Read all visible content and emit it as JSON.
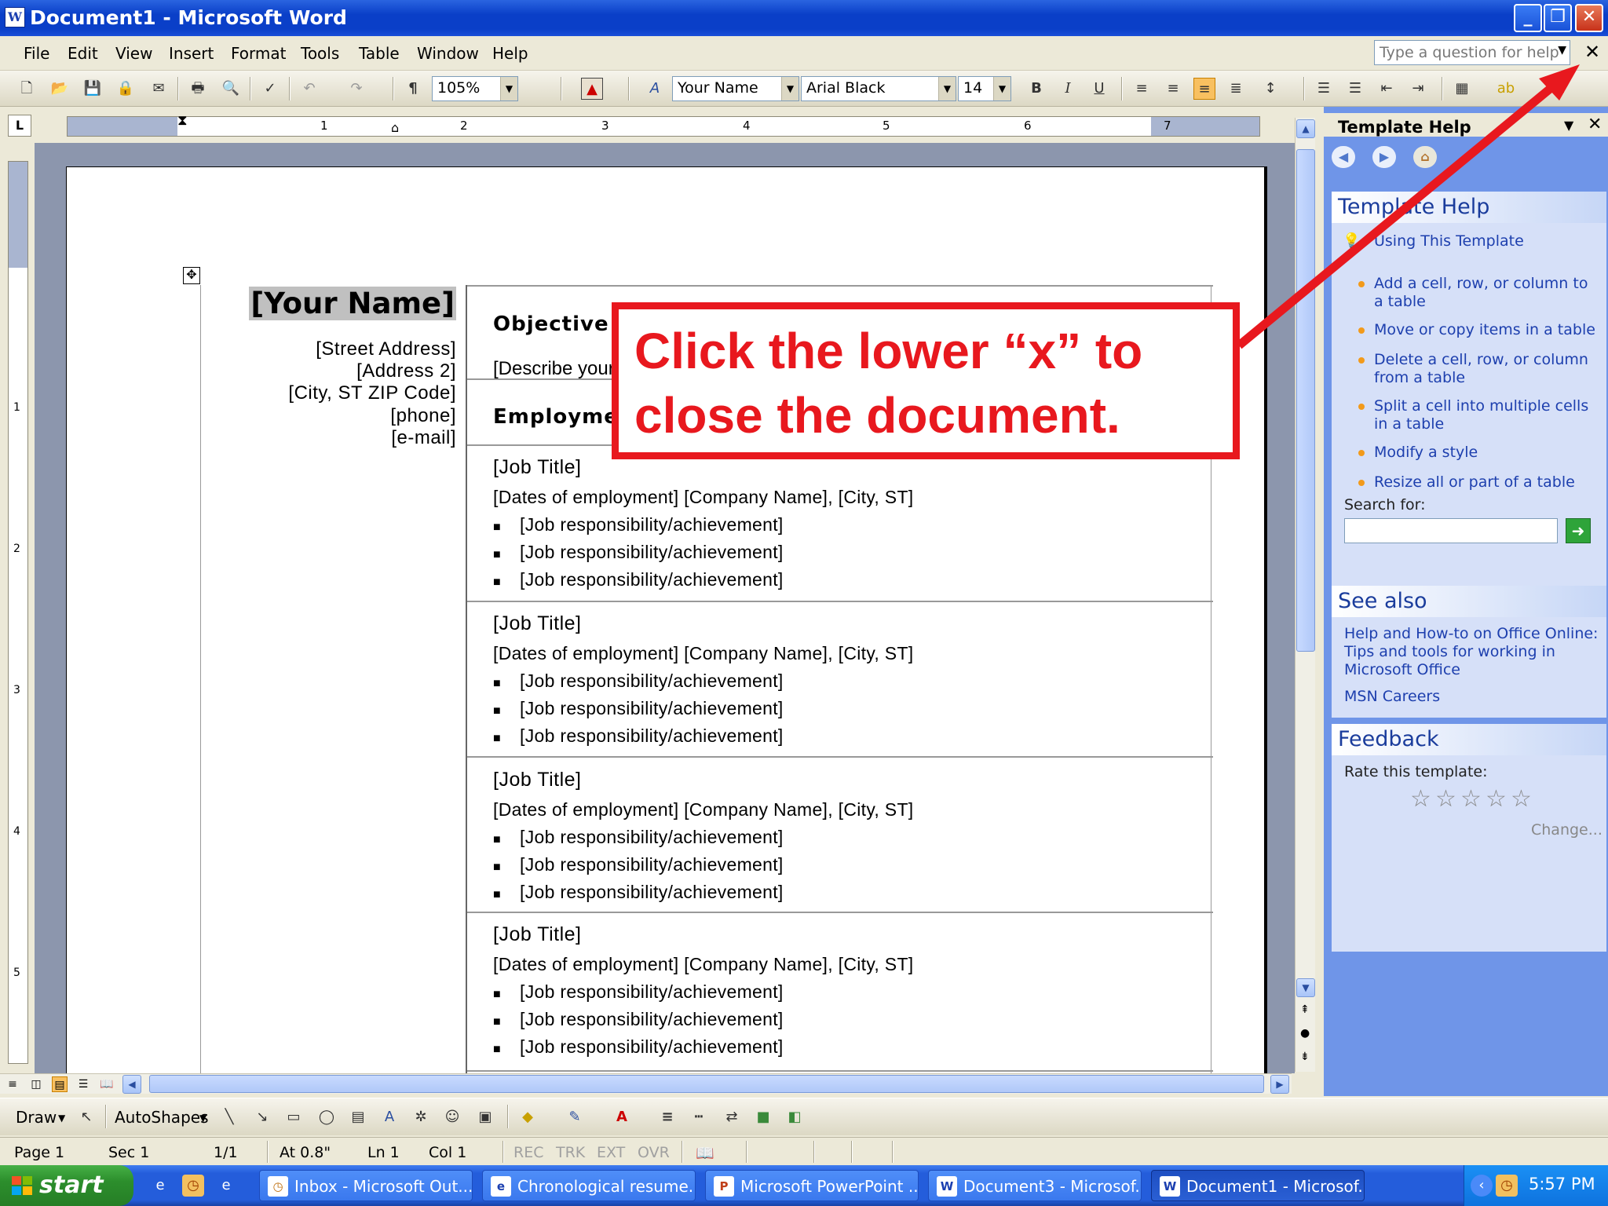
{
  "window": {
    "title": "Document1 - Microsoft Word"
  },
  "menu": {
    "items": [
      "File",
      "Edit",
      "View",
      "Insert",
      "Format",
      "Tools",
      "Table",
      "Window",
      "Help"
    ],
    "help_placeholder": "Type a question for help"
  },
  "toolbar": {
    "zoom": "105%",
    "style": "Your Name",
    "font": "Arial Black",
    "size": "14",
    "bold": "B",
    "italic": "I",
    "underline": "U"
  },
  "ruler": {
    "numbers": [
      "1",
      "2",
      "3",
      "4",
      "5",
      "6",
      "7"
    ],
    "vnumbers": [
      "1",
      "2",
      "3",
      "4",
      "5"
    ]
  },
  "resume": {
    "name": "[Your Name]",
    "address": [
      "[Street Address]",
      "[Address 2]",
      "[City, ST  ZIP Code]",
      "[phone]",
      "[e-mail]"
    ],
    "objective_heading": "Objective",
    "objective_text": "[Describe your care",
    "employment_heading": "Employment Hi",
    "jobs": [
      {
        "title": "[Job Title]",
        "dates": "[Dates of employment]  [Company Name], [City, ST]",
        "items": [
          "[Job responsibility/achievement]",
          "[Job responsibility/achievement]",
          "[Job responsibility/achievement]"
        ]
      },
      {
        "title": "[Job Title]",
        "dates": "[Dates of employment]  [Company Name], [City, ST]",
        "items": [
          "[Job responsibility/achievement]",
          "[Job responsibility/achievement]",
          "[Job responsibility/achievement]"
        ]
      },
      {
        "title": "[Job Title]",
        "dates": "[Dates of employment]  [Company Name], [City, ST]",
        "items": [
          "[Job responsibility/achievement]",
          "[Job responsibility/achievement]",
          "[Job responsibility/achievement]"
        ]
      },
      {
        "title": "[Job Title]",
        "dates": "[Dates of employment]  [Company Name], [City, ST]",
        "items": [
          "[Job responsibility/achievement]",
          "[Job responsibility/achievement]",
          "[Job responsibility/achievement]"
        ]
      }
    ]
  },
  "taskpane": {
    "title": "Template Help",
    "section1_heading": "Template Help",
    "using_template": "Using This Template",
    "links": [
      "Add a cell, row, or column to a table",
      "Move or copy items in a table",
      "Delete a cell, row, or column from a table",
      "Split a cell into multiple cells in a table",
      "Modify a style",
      "Resize all or part of a table"
    ],
    "search_label": "Search for:",
    "see_also_heading": "See also",
    "see_also_text": "Help and How-to on Office Online: Tips and tools for working in Microsoft Office",
    "msn_careers": "MSN Careers",
    "feedback_heading": "Feedback",
    "rate_label": "Rate this template:",
    "change_link": "Change..."
  },
  "drawbar": {
    "draw": "Draw",
    "autoshapes": "AutoShapes"
  },
  "status": {
    "page": "Page  1",
    "sec": "Sec  1",
    "pages": "1/1",
    "at": "At  0.8\"",
    "ln": "Ln  1",
    "col": "Col  1",
    "rec": "REC",
    "trk": "TRK",
    "ext": "EXT",
    "ovr": "OVR"
  },
  "taskbar": {
    "start": "start",
    "tasks": [
      "Inbox - Microsoft Out...",
      "Chronological resume...",
      "Microsoft PowerPoint ...",
      "Document3 - Microsof...",
      "Document1 - Microsof..."
    ],
    "clock": "5:57 PM"
  },
  "annotation": {
    "text": "Click the lower “x” to close the document."
  },
  "colors": {
    "accent_red": "#e8181e",
    "title_blue": "#0a3fc8",
    "taskpane_blue": "#6f95e8"
  }
}
